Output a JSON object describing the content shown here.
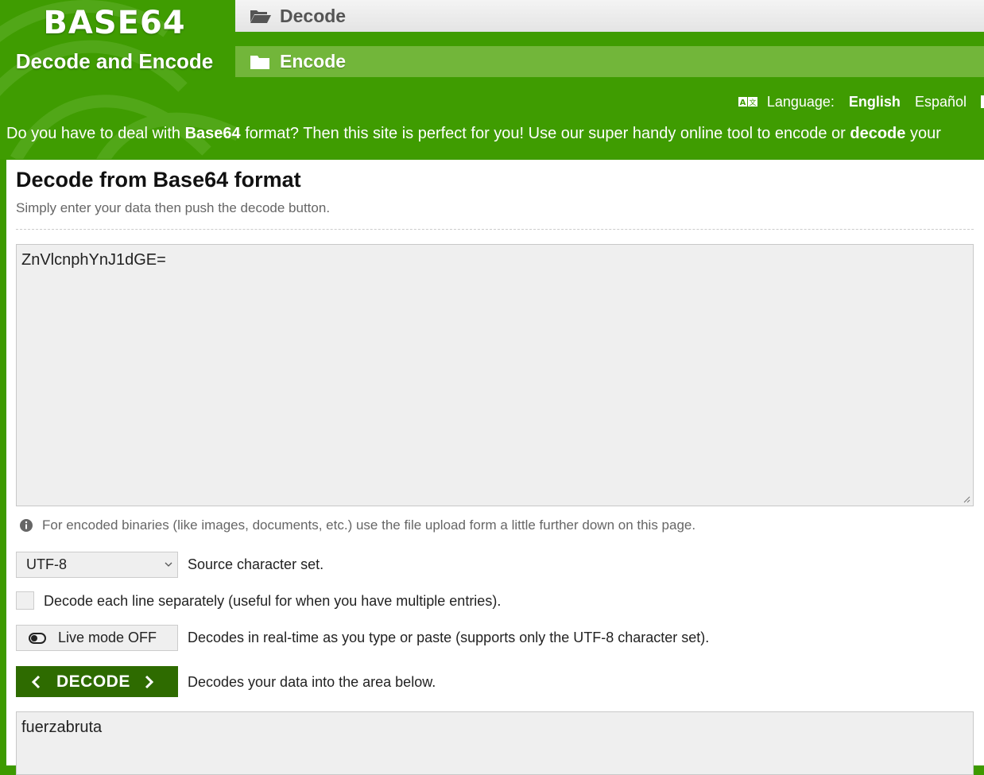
{
  "logo": {
    "title": "BASE64",
    "subtitle": "Decode and Encode"
  },
  "nav": {
    "items": [
      {
        "label": "Decode",
        "icon": "folder-open-icon"
      },
      {
        "label": "Encode",
        "icon": "folder-icon"
      }
    ]
  },
  "language": {
    "label": "Language:",
    "options": [
      "English",
      "Español"
    ],
    "selected": "English"
  },
  "intro": {
    "part1": "Do you have to deal with ",
    "bold1": "Base64",
    "part2": " format? Then this site is perfect for you! Use our super handy online tool to encode or ",
    "bold2": "decode",
    "part3": " your"
  },
  "panel": {
    "title": "Decode from Base64 format",
    "subtitle": "Simply enter your data then push the decode button.",
    "input_value": "ZnVlcnphYnJ1dGE=",
    "hint": "For encoded binaries (like images, documents, etc.) use the file upload form a little further down on this page.",
    "charset": {
      "value": "UTF-8",
      "description": "Source character set."
    },
    "line_option": {
      "label": "Decode each line separately (useful for when you have multiple entries).",
      "checked": false
    },
    "live_mode": {
      "label": "Live mode OFF",
      "description": "Decodes in real-time as you type or paste (supports only the UTF-8 character set)."
    },
    "decode_button": {
      "label": "DECODE",
      "description": "Decodes your data into the area below."
    },
    "output_value": "fuerzabruta"
  },
  "colors": {
    "brand_green": "#3f9c01",
    "button_dark_green": "#2e6b00",
    "nav_light_green": "#72b63a"
  }
}
